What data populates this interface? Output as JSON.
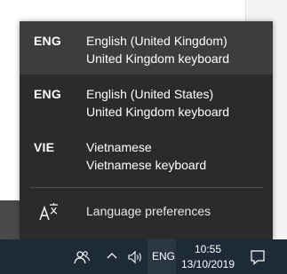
{
  "language_flyout": {
    "items": [
      {
        "code": "ENG",
        "name": "English (United Kingdom)",
        "keyboard": "United Kingdom keyboard",
        "selected": true
      },
      {
        "code": "ENG",
        "name": "English (United States)",
        "keyboard": "United Kingdom keyboard",
        "selected": false
      },
      {
        "code": "VIE",
        "name": "Vietnamese",
        "keyboard": "Vietnamese keyboard",
        "selected": false
      }
    ],
    "preferences_label": "Language preferences",
    "preferences_icon": "language-icon"
  },
  "taskbar": {
    "input_indicator": "ENG",
    "time": "10:55",
    "date": "13/10/2019",
    "icons": [
      "people-icon",
      "chevron-up-icon",
      "volume-icon",
      "action-center-icon"
    ]
  },
  "colors": {
    "flyout_bg": "#2b2b2b",
    "selected_item_bg": "#3d3d3d",
    "taskbar_bg": "#1f2a38"
  }
}
